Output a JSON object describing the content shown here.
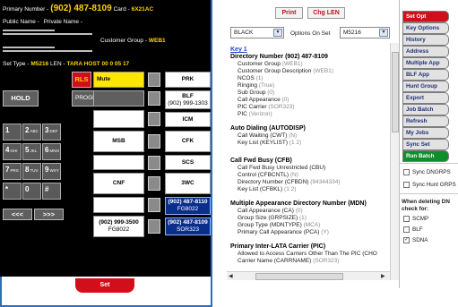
{
  "phone": {
    "primary_label": "Primary Number -",
    "primary_number": "(902) 487-8109",
    "card_label": "Card -",
    "card_value": "6X21AC",
    "public_name_label": "Public Name -",
    "private_name_label": "Private Name -",
    "customer_group_label": "Customer Group -",
    "customer_group_value": "WEB1",
    "set_type_label": "Set Type -",
    "set_type_value": "M5216",
    "len_label": "LEN -",
    "len_value": "TARA HOST 00 0 05 17",
    "rls_label": "RLS",
    "mute_label": "Mute",
    "hold_label": "HOLD",
    "program_label": "PROGRAM",
    "keypad": [
      {
        "digit": "1",
        "letters": ""
      },
      {
        "digit": "2",
        "letters": "ABC"
      },
      {
        "digit": "3",
        "letters": "DEF"
      },
      {
        "digit": "4",
        "letters": "GHI"
      },
      {
        "digit": "5",
        "letters": "JKL"
      },
      {
        "digit": "6",
        "letters": "MNO"
      },
      {
        "digit": "7",
        "letters": "PRS"
      },
      {
        "digit": "8",
        "letters": "TUV"
      },
      {
        "digit": "9",
        "letters": "WXY"
      },
      {
        "digit": "*",
        "letters": ""
      },
      {
        "digit": "0",
        "letters": ""
      },
      {
        "digit": "#",
        "letters": ""
      }
    ],
    "nav_left": "<<<",
    "nav_right": ">>>",
    "mid_keys": [
      "MSB",
      "CNF"
    ],
    "mid_bottom": {
      "line1": "(902) 999-3500",
      "line2": "FG8022"
    },
    "right_keys": [
      {
        "line1": "PRK",
        "line2": ""
      },
      {
        "line1": "BLF",
        "line2": "(902) 999-1303"
      },
      {
        "line1": "ICM",
        "line2": ""
      },
      {
        "line1": "CFK",
        "line2": ""
      },
      {
        "line1": "SCS",
        "line2": ""
      },
      {
        "line1": "3WC",
        "line2": ""
      },
      {
        "line1": "(902) 487-8110",
        "line2": "FG8022"
      },
      {
        "line1": "(902) 487-8109",
        "line2": "SOR323"
      }
    ],
    "set_button": "Set"
  },
  "toolbar": {
    "print_label": "Print",
    "chg_len_label": "Chg LEN",
    "filter_value": "BLACK",
    "options_label": "Options On Set",
    "set_value": "M5216"
  },
  "detail": {
    "key_label": "Key 1",
    "sections": [
      {
        "title": "Directory Number (902) 487-8109",
        "items": [
          {
            "label": "Customer Group",
            "value": "(WEB1)"
          },
          {
            "label": "Customer Group Description",
            "value": "(WEB1)"
          },
          {
            "label": "NCOS",
            "value": "(1)"
          },
          {
            "label": "Ringing",
            "value": "(True)"
          },
          {
            "label": "Sub Group",
            "value": "(0)"
          },
          {
            "label": "Call Appearance",
            "value": "(0)"
          },
          {
            "label": "PIC Carrier",
            "value": "(SOR323)"
          },
          {
            "label": "PIC",
            "value": "(Verizon)"
          }
        ]
      },
      {
        "title": "Auto Dialing (AUTODISP)",
        "items": [
          {
            "label": "Call Waiting (CWT)",
            "value": "(N)"
          },
          {
            "label": "Key List (KEYLIST)",
            "value": "(1 2)"
          }
        ]
      },
      {
        "title": "Call Fwd Busy (CFB)",
        "items": [
          {
            "label": "Call Fwd Busy Unrestricted (CBU)",
            "value": ""
          },
          {
            "label": "Control (CFBCNTL)",
            "value": "(N)"
          },
          {
            "label": "Directory Number (CFBDN)",
            "value": "(94344334)"
          },
          {
            "label": "Key List (CFBKL)",
            "value": "(1 2)"
          }
        ]
      },
      {
        "title": "Multiple Appearance Directory Number (MDN)",
        "items": [
          {
            "label": "Call Appearance (CA)",
            "value": "(0)"
          },
          {
            "label": "Group Size (GRPSIZE)",
            "value": "(1)"
          },
          {
            "label": "Group Type (MDNTYPE)",
            "value": "(MCA)"
          },
          {
            "label": "Primary Call Appearance (PCA)",
            "value": "(Y)"
          }
        ]
      },
      {
        "title": "Primary Inter-LATA Carrier (PIC)",
        "items": [
          {
            "label": "Allowed to Access Carriers Other Than The PIC (CHO",
            "value": ""
          },
          {
            "label": "Carrier Name (CARRNAME)",
            "value": "(SOR323)"
          }
        ]
      }
    ]
  },
  "sidebar": {
    "buttons": [
      {
        "label": "Set Opt",
        "style": "red"
      },
      {
        "label": "Key Options",
        "style": "grey"
      },
      {
        "label": "History",
        "style": "grey"
      },
      {
        "label": "Address",
        "style": "grey"
      },
      {
        "label": "Multiple App",
        "style": "grey"
      },
      {
        "label": "BLF App",
        "style": "grey"
      },
      {
        "label": "Hunt Group",
        "style": "grey"
      },
      {
        "label": "Export",
        "style": "grey"
      },
      {
        "label": "Job Batch",
        "style": "grey"
      },
      {
        "label": "Refresh",
        "style": "grey"
      },
      {
        "label": "My Jobs",
        "style": "grey"
      },
      {
        "label": "Sync Set",
        "style": "grey"
      },
      {
        "label": "Run Batch",
        "style": "green"
      }
    ],
    "sync_dngrps_label": "Sync DNGRPS",
    "sync_hunt_label": "Sync Hunt GRPS",
    "when_deleting_label": "When deleting DN check for:",
    "check_options": [
      {
        "label": "SCMP",
        "checked": false
      },
      {
        "label": "BLF",
        "checked": false
      },
      {
        "label": "SDNA",
        "checked": true
      }
    ]
  },
  "colors": {
    "accent_red": "#d10e1a",
    "accent_green": "#0e8f2c",
    "phone_bg": "#000000",
    "highlight_yellow": "#ffd200",
    "key_blue": "#0b2e8a",
    "link_blue": "#2345c5"
  }
}
